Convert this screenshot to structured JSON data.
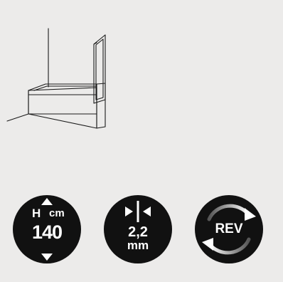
{
  "badges": {
    "height": {
      "letter": "H",
      "unit": "cm",
      "value": "140",
      "icon": "height-arrows-icon"
    },
    "thickness": {
      "value": "2,2",
      "unit": "mm",
      "icon": "glass-thickness-icon"
    },
    "reversible": {
      "label": "REV",
      "icon": "reversible-arrows-icon"
    }
  },
  "illustration": {
    "icon": "bath-screen-illustration"
  },
  "colors": {
    "background": "#ecebea",
    "badge": "#111111",
    "badge_text": "#ffffff",
    "line": "#1a1a1a"
  }
}
